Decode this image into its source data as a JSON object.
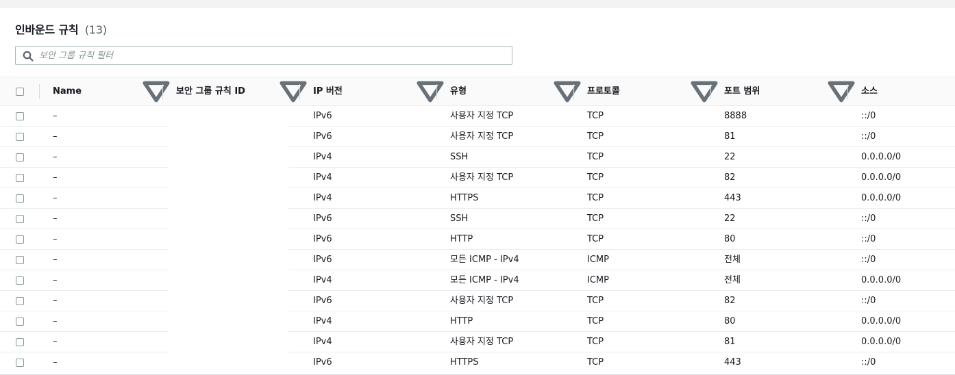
{
  "panel": {
    "title": "인바운드 규칙",
    "count": "(13)"
  },
  "search": {
    "placeholder": "보안 그룹 규칙 필터",
    "value": "",
    "icon": "search-icon"
  },
  "columns": {
    "name": "Name",
    "rule_id": "보안 그룹 규칙 ID",
    "ip_version": "IP 버전",
    "type": "유형",
    "protocol": "프로토콜",
    "port_range": "포트 범위",
    "source": "소스"
  },
  "rows": [
    {
      "name": "–",
      "ip": "IPv6",
      "type": "사용자 지정 TCP",
      "protocol": "TCP",
      "port": "8888",
      "source": "::/0"
    },
    {
      "name": "–",
      "ip": "IPv6",
      "type": "사용자 지정 TCP",
      "protocol": "TCP",
      "port": "81",
      "source": "::/0"
    },
    {
      "name": "–",
      "ip": "IPv4",
      "type": "SSH",
      "protocol": "TCP",
      "port": "22",
      "source": "0.0.0.0/0"
    },
    {
      "name": "–",
      "ip": "IPv4",
      "type": "사용자 지정 TCP",
      "protocol": "TCP",
      "port": "82",
      "source": "0.0.0.0/0"
    },
    {
      "name": "–",
      "ip": "IPv4",
      "type": "HTTPS",
      "protocol": "TCP",
      "port": "443",
      "source": "0.0.0.0/0"
    },
    {
      "name": "–",
      "ip": "IPv6",
      "type": "SSH",
      "protocol": "TCP",
      "port": "22",
      "source": "::/0"
    },
    {
      "name": "–",
      "ip": "IPv6",
      "type": "HTTP",
      "protocol": "TCP",
      "port": "80",
      "source": "::/0"
    },
    {
      "name": "–",
      "ip": "IPv6",
      "type": "모든 ICMP - IPv4",
      "protocol": "ICMP",
      "port": "전체",
      "source": "::/0"
    },
    {
      "name": "–",
      "ip": "IPv4",
      "type": "모든 ICMP - IPv4",
      "protocol": "ICMP",
      "port": "전체",
      "source": "0.0.0.0/0"
    },
    {
      "name": "–",
      "ip": "IPv6",
      "type": "사용자 지정 TCP",
      "protocol": "TCP",
      "port": "82",
      "source": "::/0"
    },
    {
      "name": "–",
      "ip": "IPv4",
      "type": "HTTP",
      "protocol": "TCP",
      "port": "80",
      "source": "0.0.0.0/0"
    },
    {
      "name": "–",
      "ip": "IPv4",
      "type": "사용자 지정 TCP",
      "protocol": "TCP",
      "port": "81",
      "source": "0.0.0.0/0"
    },
    {
      "name": "–",
      "ip": "IPv6",
      "type": "HTTPS",
      "protocol": "TCP",
      "port": "443",
      "source": "::/0"
    }
  ],
  "colors": {
    "border": "#eaeded",
    "text": "#16191f",
    "muted": "#545b64",
    "placeholder": "#879596"
  }
}
